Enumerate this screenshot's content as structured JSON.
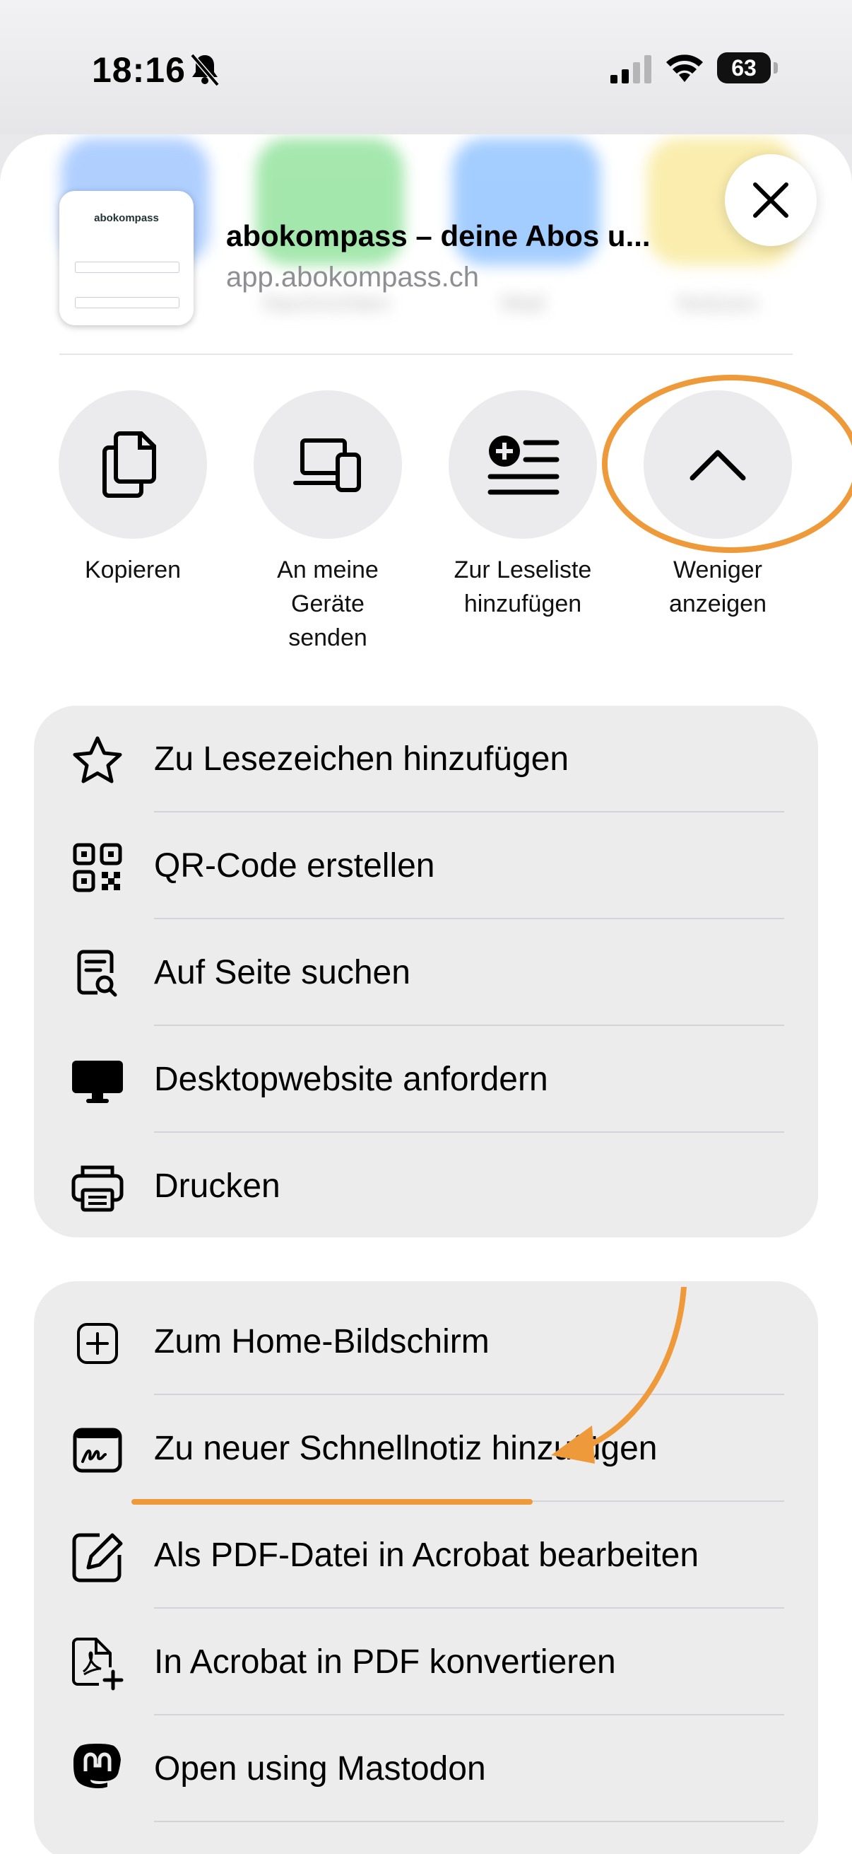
{
  "status": {
    "time": "18:16",
    "battery": "63"
  },
  "share": {
    "title": "abokompass – deine Abos u...",
    "url": "app.abokompass.ch",
    "thumb_logo": "abokompass",
    "blurred_apps": [
      {
        "label": "Nachrichten",
        "color": "#5bd46b"
      },
      {
        "label": "Mail",
        "color": "#5aa6ff"
      },
      {
        "label": "Notizen",
        "color": "#f6df6b"
      }
    ]
  },
  "actions": [
    {
      "label": "Kopieren",
      "icon": "copy-icon"
    },
    {
      "label": "An meine Geräte senden",
      "icon": "devices-icon"
    },
    {
      "label": "Zur Leseliste hinzufügen",
      "icon": "reading-list-icon"
    },
    {
      "label": "Weniger anzeigen",
      "icon": "chevron-up-icon"
    }
  ],
  "menu1": [
    {
      "label": "Zu Lesezeichen hinzufügen",
      "icon": "star-icon"
    },
    {
      "label": "QR-Code erstellen",
      "icon": "qr-code-icon"
    },
    {
      "label": "Auf Seite suchen",
      "icon": "find-on-page-icon"
    },
    {
      "label": "Desktopwebsite anfordern",
      "icon": "desktop-icon"
    },
    {
      "label": "Drucken",
      "icon": "printer-icon"
    }
  ],
  "menu2": [
    {
      "label": "Zum Home-Bildschirm",
      "icon": "add-square-icon"
    },
    {
      "label": "Zu neuer Schnellnotiz hinzufügen",
      "icon": "quick-note-icon"
    },
    {
      "label": "Als PDF-Datei in Acrobat bearbeiten",
      "icon": "edit-pdf-icon"
    },
    {
      "label": "In Acrobat in PDF konvertieren",
      "icon": "convert-pdf-icon"
    },
    {
      "label": "Open using Mastodon",
      "icon": "mastodon-icon"
    }
  ],
  "colors": {
    "highlight": "#ef9a3a"
  }
}
